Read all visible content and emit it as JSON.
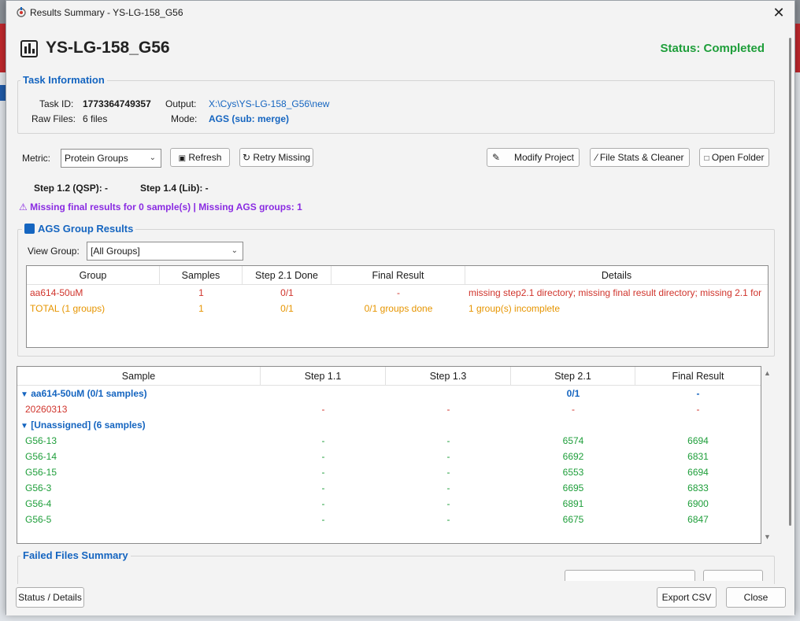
{
  "window": {
    "title": "Results Summary - YS-LG-158_G56"
  },
  "header": {
    "project": "YS-LG-158_G56",
    "status": "Status: Completed"
  },
  "task_info": {
    "legend": "Task Information",
    "task_id_label": "Task ID:",
    "task_id": "1773364749357",
    "raw_files_label": "Raw Files:",
    "raw_files": "6 files",
    "output_label": "Output:",
    "output": "X:\\Cys\\YS-LG-158_G56\\new",
    "mode_label": "Mode:",
    "mode": "AGS (sub: merge)"
  },
  "toolbar": {
    "metric_label": "Metric:",
    "metric_value": "Protein Groups",
    "refresh": "Refresh",
    "retry_missing": "Retry Missing",
    "modify_project": "Modify Project",
    "file_stats": "File Stats & Cleaner",
    "open_folder": "Open Folder"
  },
  "steps": {
    "qsp": "Step 1.2 (QSP): -",
    "lib": "Step 1.4 (Lib): -"
  },
  "warning": "Missing final results for 0 sample(s) | Missing AGS groups: 1",
  "ags": {
    "legend": "AGS Group Results",
    "view_group_label": "View Group:",
    "view_group_value": "[All Groups]",
    "columns": [
      "Group",
      "Samples",
      "Step 2.1 Done",
      "Final Result",
      "Details"
    ],
    "rows": [
      {
        "group": "aa614-50uM",
        "samples": "1",
        "step21": "0/1",
        "final": "-",
        "details": "missing step2.1 directory; missing final result directory; missing 2.1 for"
      },
      {
        "group": "TOTAL (1 groups)",
        "samples": "1",
        "step21": "0/1",
        "final": "0/1 groups done",
        "details": "1 group(s) incomplete"
      }
    ]
  },
  "samples": {
    "columns": [
      "Sample",
      "Step 1.1",
      "Step 1.3",
      "Step 2.1",
      "Final Result"
    ],
    "groups": [
      {
        "name": "aa614-50uM (0/1 samples)",
        "step21": "0/1",
        "final": "-",
        "rows": [
          {
            "name": "20260313",
            "s11": "-",
            "s13": "-",
            "s21": "-",
            "final": "-"
          }
        ]
      },
      {
        "name": "[Unassigned] (6 samples)",
        "rows": [
          {
            "name": "G56-13",
            "s11": "-",
            "s13": "-",
            "s21": "6574",
            "final": "6694"
          },
          {
            "name": "G56-14",
            "s11": "-",
            "s13": "-",
            "s21": "6692",
            "final": "6831"
          },
          {
            "name": "G56-15",
            "s11": "-",
            "s13": "-",
            "s21": "6553",
            "final": "6694"
          },
          {
            "name": "G56-3",
            "s11": "-",
            "s13": "-",
            "s21": "6695",
            "final": "6833"
          },
          {
            "name": "G56-4",
            "s11": "-",
            "s13": "-",
            "s21": "6891",
            "final": "6900"
          },
          {
            "name": "G56-5",
            "s11": "-",
            "s13": "-",
            "s21": "6675",
            "final": "6847"
          }
        ]
      }
    ]
  },
  "failed": {
    "legend": "Failed Files Summary"
  },
  "footer": {
    "status_details": "Status / Details",
    "export_csv": "Export CSV",
    "close": "Close"
  },
  "colors": {
    "accent": "#1565c0",
    "success": "#1e9e3a",
    "error": "#d0342c",
    "warning": "#e69500",
    "alert": "#8a2be2"
  }
}
